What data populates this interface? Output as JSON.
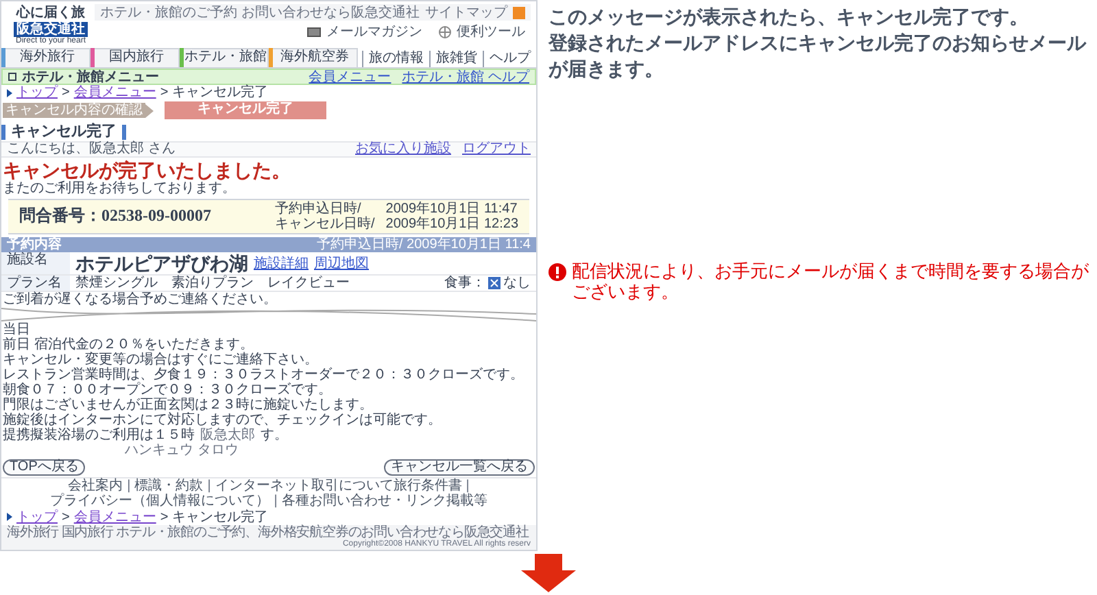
{
  "header": {
    "tagline": "心に届く旅",
    "logo": "阪急交通社",
    "slogan": "Direct to your heart",
    "top_text": "ホテル・旅館のご予約 お問い合わせなら阪急交通社",
    "sitemap": "サイトマップ",
    "utility_links": [
      "メールマガジン",
      "便利ツール"
    ]
  },
  "tabs": [
    {
      "label": "海外旅行",
      "color": "#5b9bd5"
    },
    {
      "label": "国内旅行",
      "color": "#e05a9c"
    },
    {
      "label": "ホテル・旅館",
      "color": "#6abf4b"
    },
    {
      "label": "海外航空券",
      "color": "#f0a030"
    }
  ],
  "side_tabs": [
    "旅の情報",
    "旅雑貨",
    "ヘルプ"
  ],
  "menu_bar": {
    "title": "ホテル・旅館メニュー",
    "links": [
      "会員メニュー",
      "ホテル・旅館 ヘルプ"
    ]
  },
  "breadcrumb": {
    "items": [
      "トップ",
      "会員メニュー",
      "キャンセル完了"
    ],
    "separator": ">"
  },
  "steps": [
    {
      "label": "キャンセル内容の確認",
      "selected": false
    },
    {
      "label": "キャンセル完了",
      "selected": true
    }
  ],
  "heading": "キャンセル完了",
  "greeting": "こんにちは、阪急太郎 さん",
  "user_links": [
    "お気に入り施設",
    "ログアウト"
  ],
  "message": "キャンセルが完了いたしました。",
  "submessage": "またのご利用をお待ちしております。",
  "inquiry": {
    "number": "問合番号：02538-09-00007",
    "dates": [
      {
        "label": "予約申込日時/",
        "value": "2009年10月1日 11:47"
      },
      {
        "label": "キャンセル日時/",
        "value": "2009年10月1日 12:23"
      }
    ]
  },
  "reservation": {
    "title": "予約内容",
    "date": "予約申込日時/ 2009年10月1日 11:4",
    "facility_label": "施設名",
    "facility": "ホテルピアザびわ湖",
    "facility_links": [
      "施設詳細",
      "周辺地図"
    ],
    "plan_label": "プラン名",
    "plan": "禁煙シングル　素泊りプラン　レイクビュー",
    "meal_label": "食事：",
    "meal_checked": true,
    "meal": "なし",
    "notice": "ご到着が遅くなる場合予めご連絡ください。"
  },
  "notes": [
    "当日",
    "前日 宿泊代金の２０％をいただきます。",
    "キャンセル・変更等の場合はすぐにご連絡下さい。",
    "レストラン営業時間は、夕食１９：３０ラストオーダーで２０：３０クローズです。",
    "朝食０７：００オープンで０９：３０クローズです。",
    "門限はございませんが正面玄関は２３時に施錠いたします。",
    "施錠後はインターホンにて対応しますので、チェックインは可能です。",
    "提携擬装浴場のご利用は１５時"
  ],
  "name_kanji": "阪急太郎",
  "notes_tail": "す。",
  "name_kana": "ハンキュウ タロウ",
  "buttons": [
    "TOPへ戻る",
    "キャンセル一覧へ戻る"
  ],
  "footer_links": [
    "会社案内",
    "標識・約款",
    "インターネット取引について旅行条件書",
    "プライバシー（個人情報について）",
    "各種お問い合わせ・リンク掲載等"
  ],
  "footer_separator": "|",
  "footer_breadcrumb": [
    "トップ",
    "会員メニュー",
    "キャンセル完了"
  ],
  "footer_text": "海外旅行 国内旅行 ホテル・旅館のご予約、海外格安航空券のお問い合わせなら阪急交通社",
  "copyright": "Copyright©2008 HANKYU TRAVEL All rights reserv",
  "explanation": [
    "このメッセージが表示されたら、キャンセル完了です。",
    "登録されたメールアドレスにキャンセル完了のお知らせメールが届きます。"
  ],
  "warning": "配信状況により、お手元にメールが届くまで時間を要する場合がございます。"
}
